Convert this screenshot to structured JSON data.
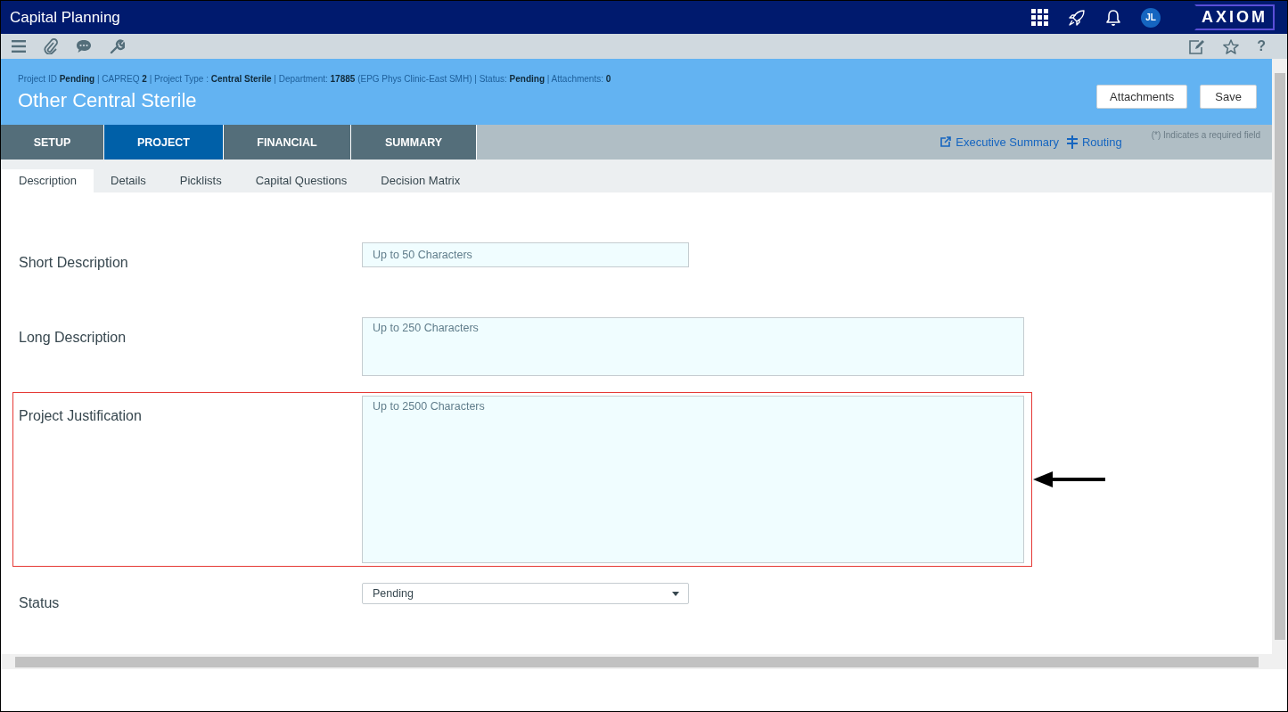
{
  "app": {
    "title": "Capital Planning",
    "avatar": "JL",
    "logo": "AXIOM"
  },
  "toolbar": {
    "help": "?"
  },
  "header": {
    "info": "Project ID **Pending** | CAPREQ **2** | Project Type : **Central Sterile** | Department: **17885** (EPG Phys Clinic-East SMH) | Status: **Pending** | Attachments: **0**",
    "title": "Other Central Sterile",
    "buttons": [
      "Attachments",
      "Save"
    ]
  },
  "main_tabs": [
    {
      "label": "SETUP",
      "selected": false
    },
    {
      "label": "PROJECT",
      "selected": true
    },
    {
      "label": "FINANCIAL",
      "selected": false
    },
    {
      "label": "SUMMARY",
      "selected": false
    }
  ],
  "links": [
    {
      "label": "Executive Summary",
      "kind": "external"
    },
    {
      "label": "Routing",
      "kind": "routing"
    }
  ],
  "required_note": "(*) Indicates a required field",
  "sub_tabs": [
    {
      "label": "Description",
      "selected": true
    },
    {
      "label": "Details",
      "selected": false
    },
    {
      "label": "Picklists",
      "selected": false
    },
    {
      "label": "Capital Questions",
      "selected": false
    },
    {
      "label": "Decision Matrix",
      "selected": false
    }
  ],
  "fields": [
    {
      "label": "Short Description",
      "kind": "input",
      "placeholder": "Up to 50 Characters",
      "highlighted": false
    },
    {
      "label": "Long Description",
      "kind": "textarea",
      "placeholder": "Up to 250 Characters",
      "highlighted": false
    },
    {
      "label": "Project Justification",
      "kind": "largetextarea",
      "placeholder": "Up to 2500 Characters",
      "highlighted": true
    },
    {
      "label": "Status",
      "kind": "select",
      "value": "Pending",
      "highlighted": false
    }
  ]
}
